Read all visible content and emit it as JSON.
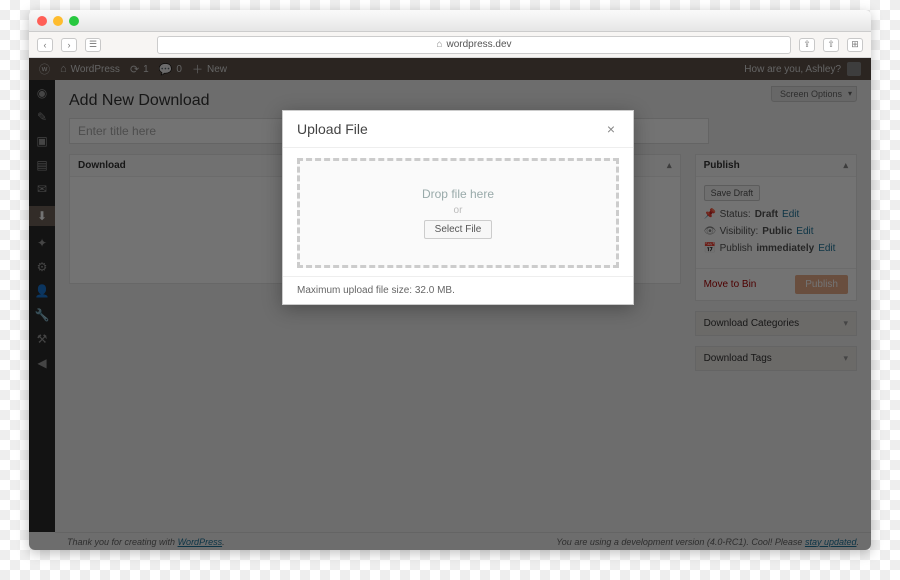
{
  "browser": {
    "address": "wordpress.dev"
  },
  "adminbar": {
    "site_name": "WordPress",
    "updates_count": "1",
    "comments_count": "0",
    "new_label": "New",
    "greeting": "How are you, Ashley?"
  },
  "screen_options_label": "Screen Options",
  "page_title": "Add New Download",
  "title_input_placeholder": "Enter title here",
  "download_box": {
    "title": "Download"
  },
  "publish_box": {
    "title": "Publish",
    "save_draft": "Save Draft",
    "status_label": "Status:",
    "status_value": "Draft",
    "visibility_label": "Visibility:",
    "visibility_value": "Public",
    "publish_label": "Publish",
    "publish_value": "immediately",
    "edit_label": "Edit",
    "move_to_bin": "Move to Bin",
    "publish_button": "Publish"
  },
  "categories_box": {
    "title": "Download Categories"
  },
  "tags_box": {
    "title": "Download Tags"
  },
  "footer": {
    "left_pre": "Thank you for creating with ",
    "left_link": "WordPress",
    "right_pre": "You are using a development version (4.0-RC1). Cool! Please ",
    "right_link": "stay updated"
  },
  "modal": {
    "title": "Upload File",
    "drop_text": "Drop file here",
    "or_text": "or",
    "select_button": "Select File",
    "max_size": "Maximum upload file size: 32.0 MB."
  }
}
